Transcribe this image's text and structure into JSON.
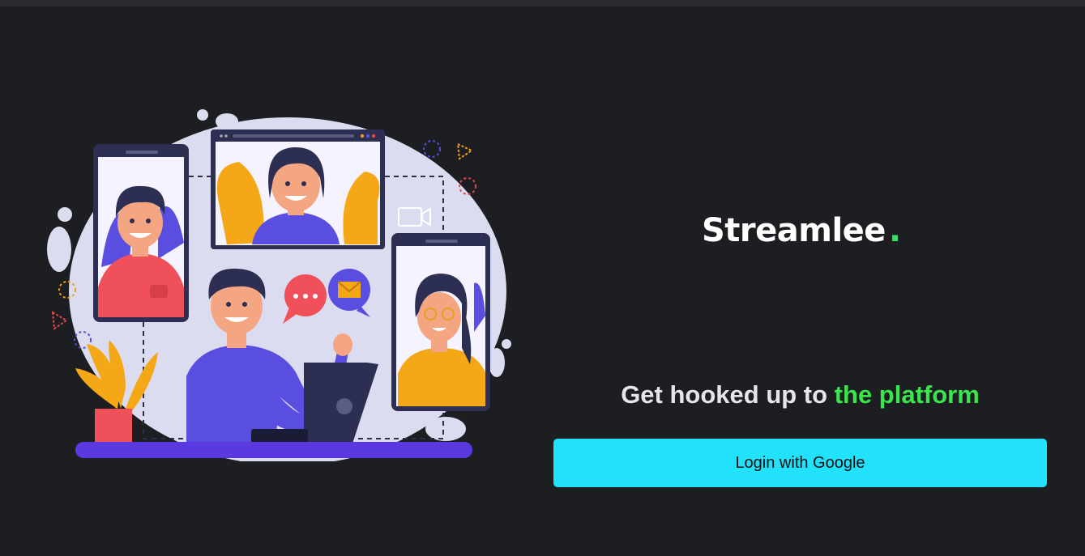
{
  "brand": {
    "name": "Streamlee",
    "dot": "."
  },
  "tagline": {
    "lead": "Get hooked up to ",
    "highlight": "the platform"
  },
  "login": {
    "label": "Login with Google"
  },
  "colors": {
    "background": "#1d1e22",
    "brand_dot": "#2ee35f",
    "highlight": "#39e64b",
    "button": "#22e1fb"
  }
}
